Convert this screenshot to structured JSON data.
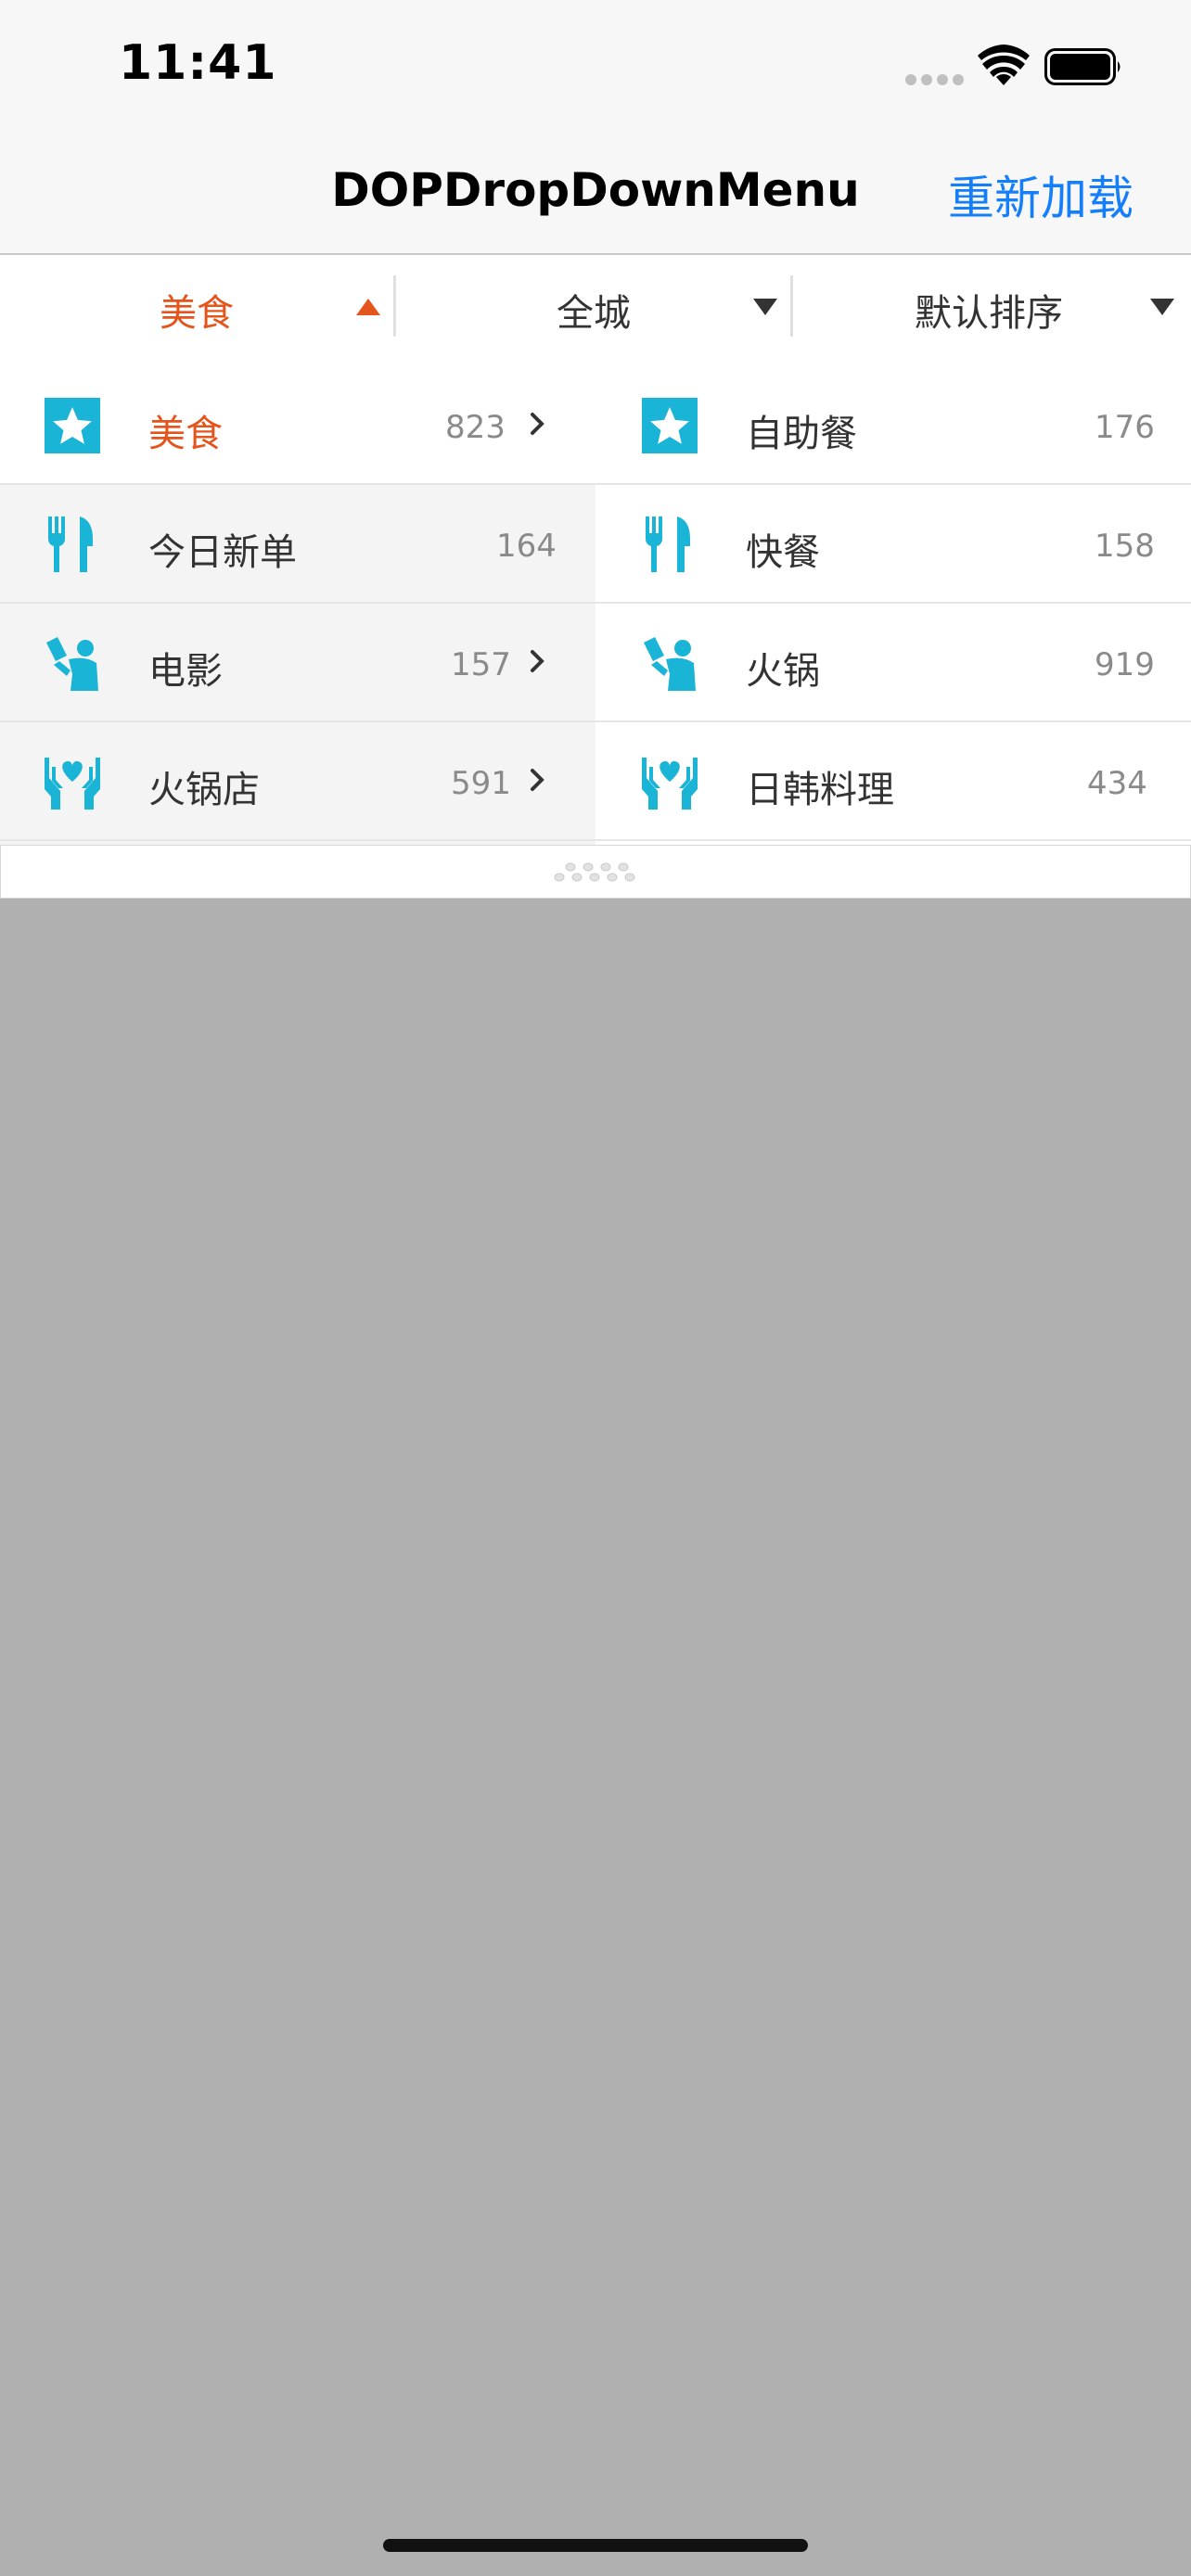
{
  "status_bar": {
    "time": "11:41"
  },
  "nav": {
    "title": "DOPDropDownMenu",
    "reload_label": "重新加载"
  },
  "filters": [
    {
      "label": "美食",
      "active": true
    },
    {
      "label": "全城",
      "active": false
    },
    {
      "label": "默认排序",
      "active": false
    }
  ],
  "left_list": [
    {
      "icon": "star-icon",
      "name": "美食",
      "count": "823",
      "has_children": true,
      "selected": true
    },
    {
      "icon": "fork-knife-icon",
      "name": "今日新单",
      "count": "164",
      "has_children": false,
      "selected": false
    },
    {
      "icon": "person-drinking-icon",
      "name": "电影",
      "count": "157",
      "has_children": true,
      "selected": false
    },
    {
      "icon": "hands-heart-icon",
      "name": "火锅店",
      "count": "591",
      "has_children": true,
      "selected": false
    }
  ],
  "right_list": [
    {
      "icon": "star-icon",
      "name": "自助餐",
      "count": "176"
    },
    {
      "icon": "fork-knife-icon",
      "name": "快餐",
      "count": "158"
    },
    {
      "icon": "person-drinking-icon",
      "name": "火锅",
      "count": "919"
    },
    {
      "icon": "hands-heart-icon",
      "name": "日韩料理",
      "count": "434"
    }
  ],
  "colors": {
    "accent": "#e5541a",
    "icon": "#1ab4d6",
    "link": "#147efb",
    "overlay": "#b0b0b0",
    "left_panel_bg": "#f4f4f4",
    "selected_row_bg": "#ffffff"
  }
}
